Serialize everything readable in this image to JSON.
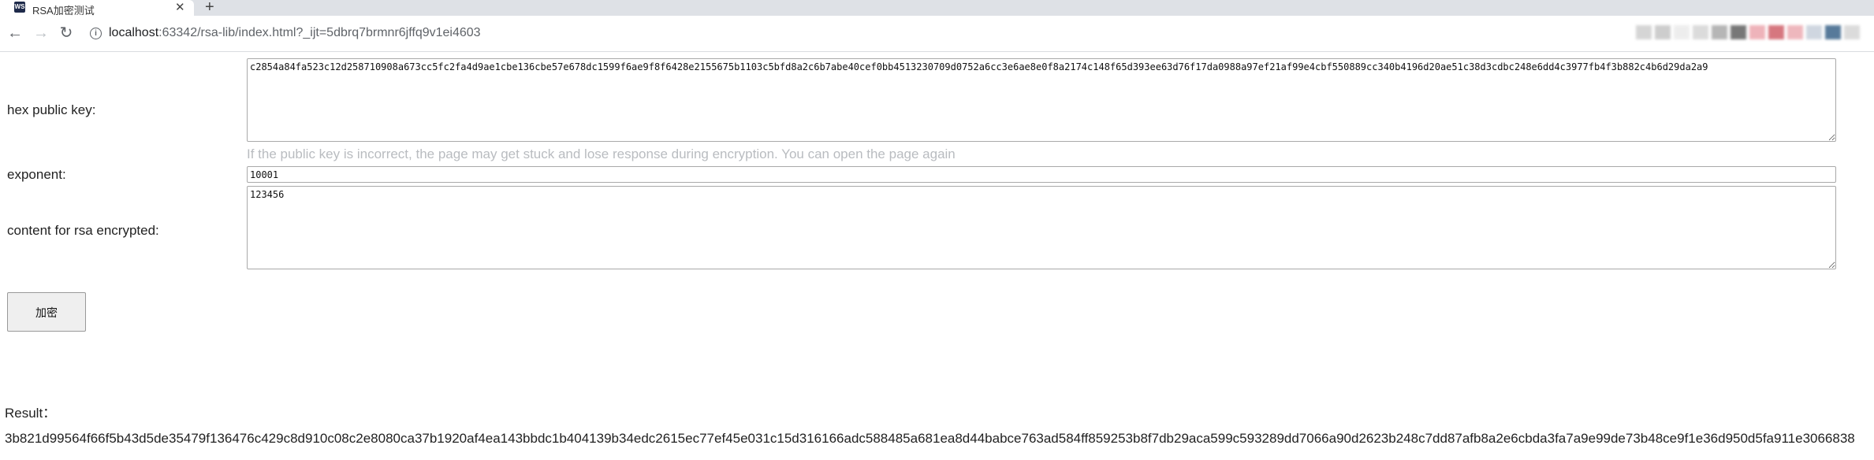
{
  "browser": {
    "tab_title": "RSA加密测试",
    "tab_favicon": "WS",
    "url_host": "localhost",
    "url_rest": ":63342/rsa-lib/index.html?_ijt=5dbrq7brmnr6jffq9v1ei4603",
    "extension_icon_colors": [
      "#c8c8c8",
      "#bdbdbd",
      "#e8e8e8",
      "#cfcfcf",
      "#9e9e9e",
      "#4a4a4a",
      "#e99aa3",
      "#c94a55",
      "#e9a0a8",
      "#bfc9d6",
      "#1f4e79",
      "#d0d0d0"
    ]
  },
  "form": {
    "hex_public_key_label": "hex public key:",
    "hex_public_key_value": "c2854a84fa523c12d258710908a673cc5fc2fa4d9ae1cbe136cbe57e678dc1599f6ae9f8f6428e2155675b1103c5bfd8a2c6b7abe40cef0bb4513230709d0752a6cc3e6ae8e0f8a2174c148f65d393ee63d76f17da0988a97ef21af99e4cbf550889cc340b4196d20ae51c38d3cdbc248e6dd4c3977fb4f3b882c4b6d29da2a9",
    "hint": "If the public key is incorrect, the page may get stuck and lose response during encryption. You can open the page again",
    "exponent_label": "exponent:",
    "exponent_value": "10001",
    "content_label": "content for rsa encrypted:",
    "content_value": "123456",
    "encrypt_button": "加密"
  },
  "result": {
    "label": "Result：",
    "value": "3b821d99564f66f5b43d5de35479f136476c429c8d910c08c2e8080ca37b1920af4ea143bbdc1b404139b34edc2615ec77ef45e031c15d316166adc588485a681ea8d44babce763ad584ff859253b8f7db29aca599c593289dd7066a90d2623b248c7dd87afb8a2e6cbda3fa7a9e99de73b48ce9f1e36d950d5fa911e3066838"
  }
}
